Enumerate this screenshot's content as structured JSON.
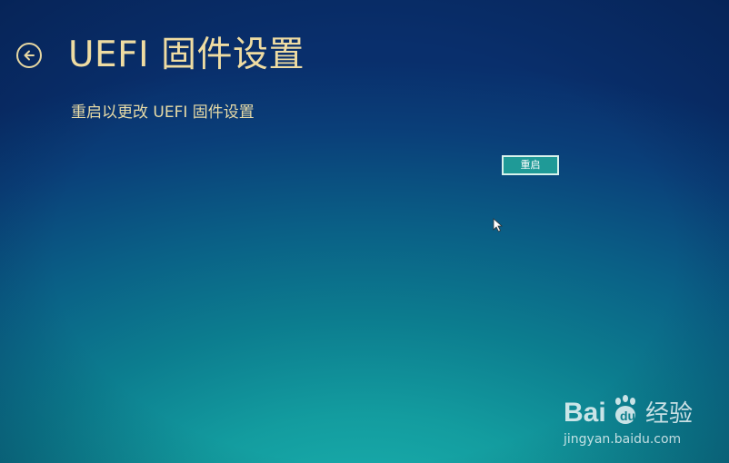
{
  "header": {
    "title": "UEFI 固件设置",
    "back_icon": "back-arrow-icon"
  },
  "main": {
    "description": "重启以更改 UEFI 固件设置",
    "restart_button_label": "重启"
  },
  "watermark": {
    "logo_text": "Bai 经验",
    "url": "jingyan.baidu.com"
  },
  "colors": {
    "title": "#efdca2",
    "background_top": "#092f6c",
    "background_bottom": "#1bb4b0",
    "button_fill": "#1f9a97"
  }
}
